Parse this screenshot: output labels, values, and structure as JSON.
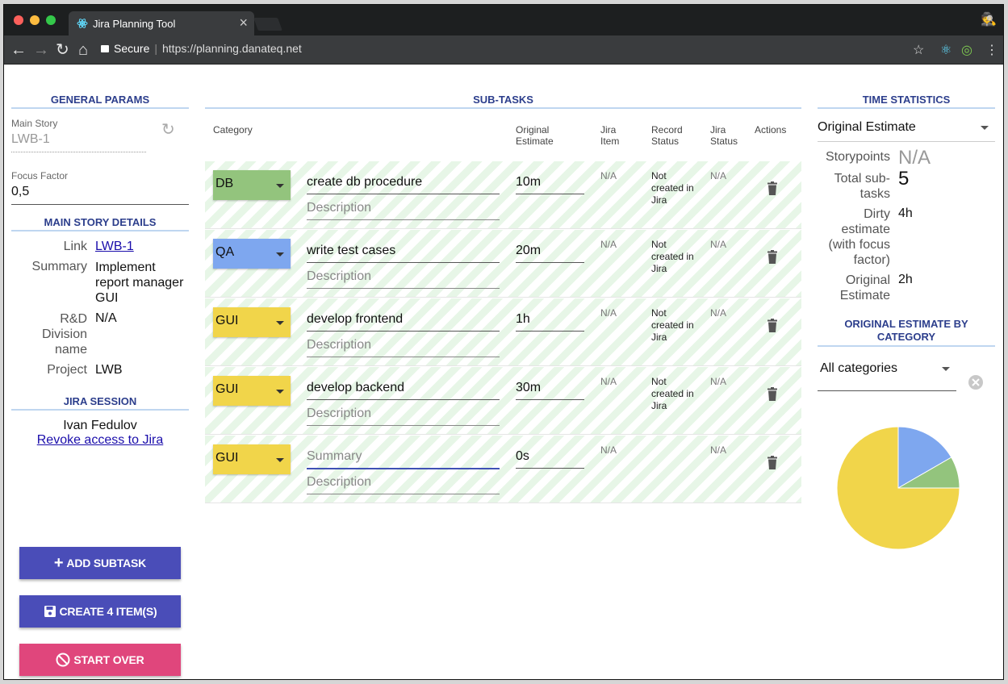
{
  "browser": {
    "tab_title": "Jira Planning Tool",
    "secure_label": "Secure",
    "url": "https://planning.danateq.net"
  },
  "general": {
    "title": "GENERAL PARAMS",
    "main_story_label": "Main Story",
    "main_story_value": "LWB-1",
    "focus_label": "Focus Factor",
    "focus_value": "0,5"
  },
  "details": {
    "title": "MAIN STORY DETAILS",
    "link_label": "Link",
    "link_value": "LWB-1",
    "summary_label": "Summary",
    "summary_value": "Implement report manager GUI",
    "division_label": "R&D Division name",
    "division_value": "N/A",
    "project_label": "Project",
    "project_value": "LWB"
  },
  "session": {
    "title": "JIRA SESSION",
    "user": "Ivan Fedulov",
    "revoke": "Revoke access to Jira"
  },
  "buttons": {
    "add": "ADD SUBTASK",
    "create": "CREATE 4 ITEM(S)",
    "start_over": "START OVER"
  },
  "subtasks": {
    "title": "SUB-TASKS",
    "columns": {
      "category": "Category",
      "estimate": "Original Estimate",
      "jira_item": "Jira Item",
      "record_status": "Record Status",
      "jira_status": "Jira Status",
      "actions": "Actions"
    },
    "rows": [
      {
        "category": "DB",
        "color": "#93c47d",
        "summary": "create db procedure",
        "summary_placeholder": "",
        "description": "Description",
        "estimate": "10m",
        "jira_item": "N/A",
        "record_status": "Not created in Jira",
        "jira_status": "N/A"
      },
      {
        "category": "QA",
        "color": "#7ea7ef",
        "summary": "write test cases",
        "summary_placeholder": "",
        "description": "Description",
        "estimate": "20m",
        "jira_item": "N/A",
        "record_status": "Not created in Jira",
        "jira_status": "N/A"
      },
      {
        "category": "GUI",
        "color": "#f1d54a",
        "summary": "develop frontend",
        "summary_placeholder": "",
        "description": "Description",
        "estimate": "1h",
        "jira_item": "N/A",
        "record_status": "Not created in Jira",
        "jira_status": "N/A"
      },
      {
        "category": "GUI",
        "color": "#f1d54a",
        "summary": "develop backend",
        "summary_placeholder": "",
        "description": "Description",
        "estimate": "30m",
        "jira_item": "N/A",
        "record_status": "Not created in Jira",
        "jira_status": "N/A"
      },
      {
        "category": "GUI",
        "color": "#f1d54a",
        "summary": "",
        "summary_placeholder": "Summary",
        "description": "Description",
        "estimate": "0s",
        "jira_item": "N/A",
        "record_status": "",
        "jira_status": "N/A"
      }
    ]
  },
  "time": {
    "title": "TIME STATISTICS",
    "select": "Original Estimate",
    "storypoints_label": "Storypoints",
    "storypoints_value": "N/A",
    "total_label": "Total sub-tasks",
    "total_value": "5",
    "dirty_label": "Dirty estimate (with focus factor)",
    "dirty_value": "4h",
    "original_label": "Original Estimate",
    "original_value": "2h",
    "by_category_title": "ORIGINAL ESTIMATE BY CATEGORY",
    "category_select": "All categories"
  },
  "chart_data": {
    "type": "pie",
    "series": [
      {
        "name": "QA",
        "value": 20,
        "color": "#7ea7ef"
      },
      {
        "name": "DB",
        "value": 10,
        "color": "#93c47d"
      },
      {
        "name": "GUI",
        "value": 90,
        "color": "#f1d54a"
      }
    ]
  }
}
